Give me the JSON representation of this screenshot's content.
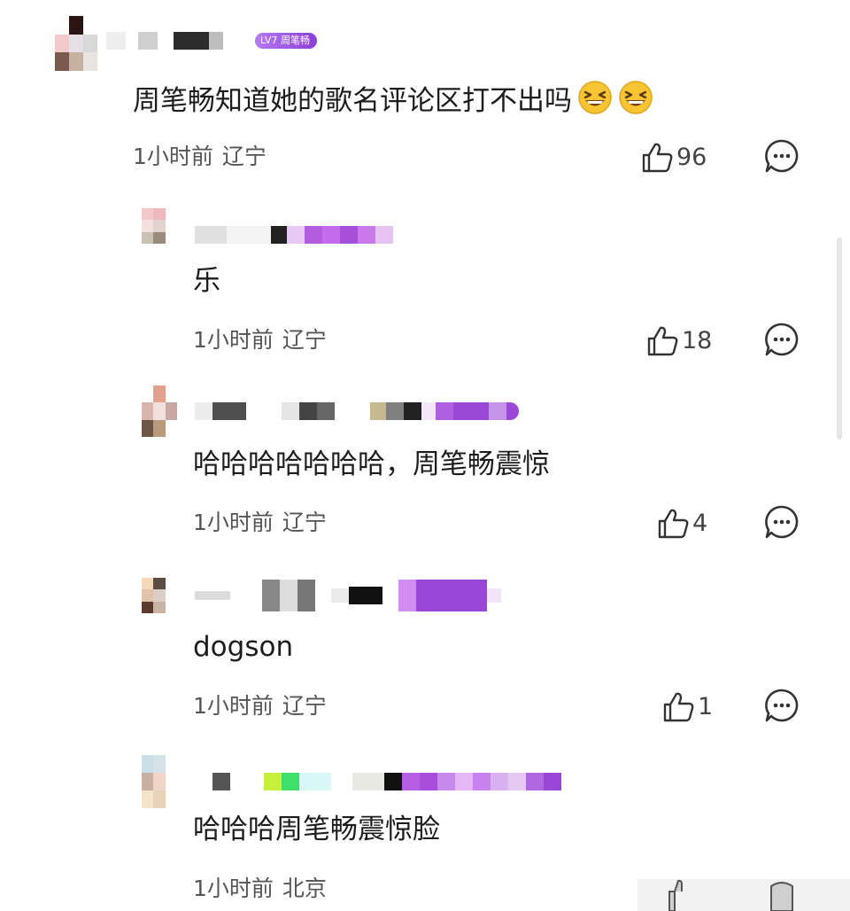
{
  "colors": {
    "text_primary": "#1d1d1d",
    "text_meta": "#555555",
    "badge_purple": "#8b3fd6"
  },
  "main_comment": {
    "level_badge": "LV7 周笔畅",
    "text": "周笔畅知道她的歌名评论区打不出吗",
    "emojis": [
      "grinning-squinting-face",
      "grinning-squinting-face"
    ],
    "time": "1小时前",
    "location": "辽宁",
    "likes": "96"
  },
  "replies": [
    {
      "text": "乐",
      "time": "1小时前",
      "location": "辽宁",
      "likes": "18"
    },
    {
      "text": "哈哈哈哈哈哈哈，周笔畅震惊",
      "time": "1小时前",
      "location": "辽宁",
      "likes": "4"
    },
    {
      "text": "dogson",
      "time": "1小时前",
      "location": "辽宁",
      "likes": "1"
    },
    {
      "text": "哈哈哈周笔畅震惊脸",
      "time": "1小时前",
      "location": "北京",
      "likes": ""
    }
  ],
  "icons": {
    "like": "thumbs-up-icon",
    "reply": "comment-bubble-icon"
  }
}
